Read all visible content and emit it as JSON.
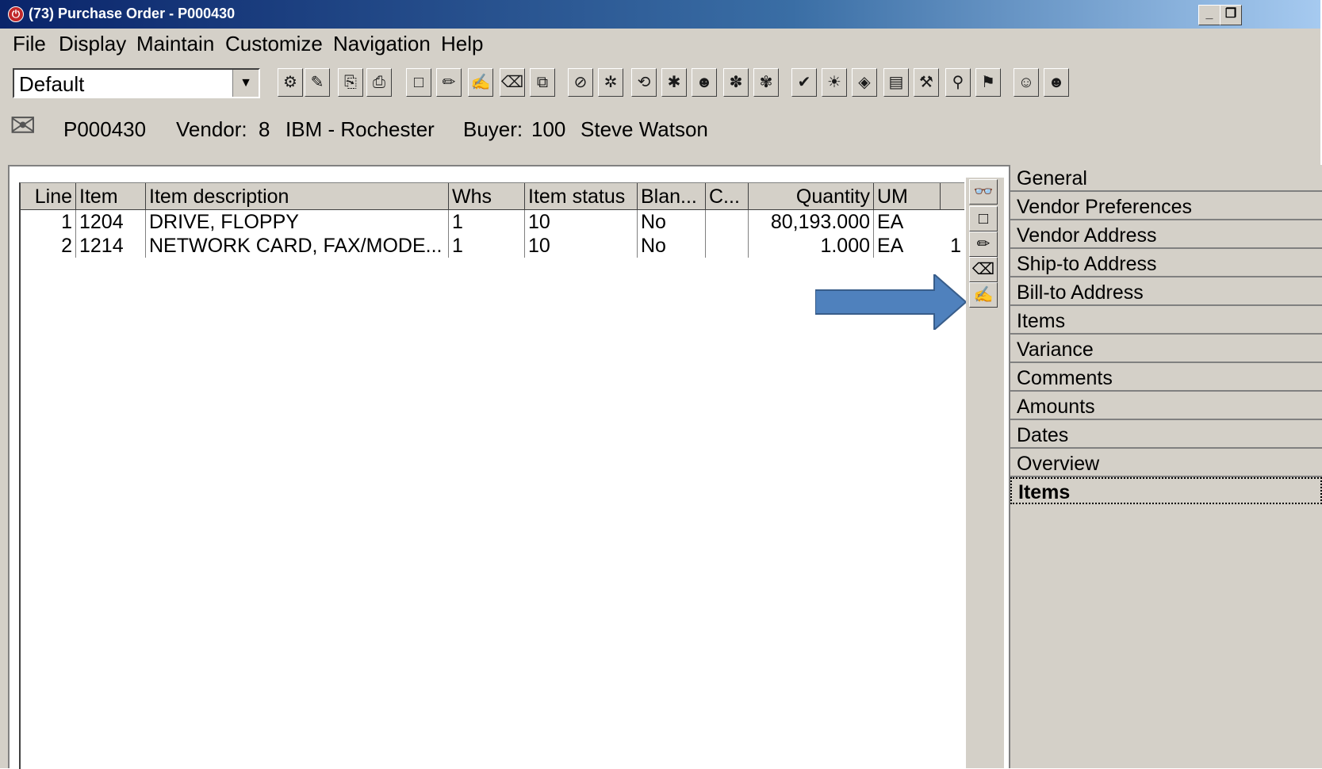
{
  "window": {
    "title": "(73) Purchase Order - P000430",
    "app_icon": "erp-logo-icon",
    "minimize_label": "_",
    "restore_label": "❐"
  },
  "menubar": [
    "File",
    "Display",
    "Maintain",
    "Customize",
    "Navigation",
    "Help"
  ],
  "toolbar": {
    "view_select_value": "Default",
    "buttons": [
      "select-icon",
      "note-icon",
      "copy-icon",
      "print-icon",
      "new-icon",
      "edit-icon",
      "edit-notes-icon",
      "delete-icon",
      "duplicate-icon",
      "cancel-icon",
      "chart-icon",
      "history-icon",
      "receipts-icon",
      "vendor-icon",
      "lines-icon",
      "schedule-icon",
      "approve-icon",
      "action-icon",
      "release-icon",
      "report-icon",
      "tools-icon",
      "inquiry-icon",
      "workflow-icon",
      "user-icon",
      "team-icon"
    ]
  },
  "header": {
    "po_number": "P000430",
    "vendor_label": "Vendor:",
    "vendor_id": "8",
    "vendor_name": "IBM - Rochester",
    "buyer_label": "Buyer:",
    "buyer_id": "100",
    "buyer_name": "Steve Watson"
  },
  "grid": {
    "columns": [
      "Line",
      "Item",
      "Item description",
      "Whs",
      "Item status",
      "Blan...",
      "C...",
      "Quantity",
      "UM",
      ""
    ],
    "rows": [
      {
        "line": "1",
        "item": "1204",
        "description": "DRIVE, FLOPPY",
        "whs": "1",
        "status": "10",
        "blanket": "No",
        "c": "",
        "quantity": "80,193.000",
        "um": "EA",
        "extra": ""
      },
      {
        "line": "2",
        "item": "1214",
        "description": "NETWORK CARD, FAX/MODE...",
        "whs": "1",
        "status": "10",
        "blanket": "No",
        "c": "",
        "quantity": "1.000",
        "um": "EA",
        "extra": "1"
      }
    ]
  },
  "side_tools": [
    "view-icon",
    "new-line-icon",
    "edit-line-icon",
    "delete-line-icon",
    "edit-notes-icon"
  ],
  "nav": {
    "items": [
      "General",
      "Vendor Preferences",
      "Vendor Address",
      "Ship-to Address",
      "Bill-to Address",
      "Items",
      "Variance",
      "Comments",
      "Amounts",
      "Dates",
      "Overview",
      "Items"
    ],
    "active_index": 11
  },
  "annotation": {
    "arrow_color": "#4f81bd"
  }
}
